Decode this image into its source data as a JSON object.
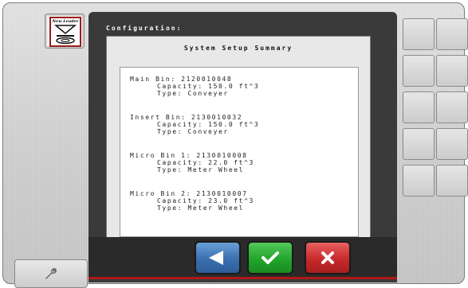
{
  "logo": {
    "brand_text": "New Leader"
  },
  "screen": {
    "title": "Configuration:",
    "panel_title": "System Setup Summary",
    "bins": [
      {
        "header": "Main Bin: 2120010048",
        "capacity": "Capacity: 150.0 ft^3",
        "type": "Type: Conveyer"
      },
      {
        "header": "Insert Bin: 2130010032",
        "capacity": "Capacity: 150.0 ft^3",
        "type": "Type: Conveyer"
      },
      {
        "header": "Micro Bin 1: 2130010008",
        "capacity": "Capacity: 22.0 ft^3",
        "type": "Type: Meter Wheel"
      },
      {
        "header": "Micro Bin 2: 2130010007",
        "capacity": "Capacity: 23.0 ft^3",
        "type": "Type: Meter Wheel"
      }
    ]
  },
  "nav_buttons": {
    "back_icon": "left-arrow-icon",
    "confirm_icon": "checkmark-icon",
    "cancel_icon": "x-icon"
  },
  "side_tool": {
    "icon": "wrench-icon"
  },
  "colors": {
    "back_blue": "#3a6fb0",
    "confirm_green": "#22a52b",
    "cancel_red": "#c82a2a",
    "accent_red_line": "#b01818"
  }
}
